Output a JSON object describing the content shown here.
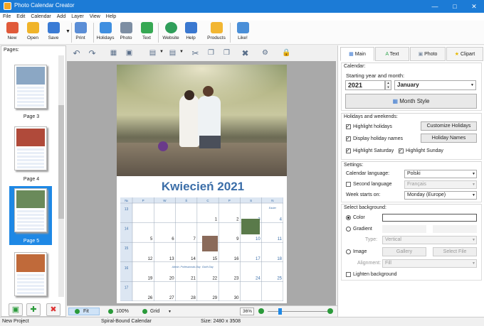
{
  "window": {
    "title": "Photo Calendar Creator"
  },
  "menu": [
    "File",
    "Edit",
    "Calendar",
    "Add",
    "Layer",
    "View",
    "Help"
  ],
  "toolbar": [
    {
      "label": "New",
      "icon": "new-document-icon",
      "color": "#e05a3a"
    },
    {
      "label": "Open",
      "icon": "open-folder-icon",
      "color": "#f0b429"
    },
    {
      "label": "Save",
      "icon": "save-disk-icon",
      "color": "#3a7bd5"
    },
    {
      "label": "Print",
      "icon": "printer-icon",
      "color": "#5b8ed6"
    },
    {
      "label": "Holidays",
      "icon": "holidays-calendar-icon",
      "color": "#3f8fe0"
    },
    {
      "label": "Photo",
      "icon": "camera-icon",
      "color": "#7d8ea3"
    },
    {
      "label": "Text",
      "icon": "text-letter-a-icon",
      "color": "#36a853"
    },
    {
      "label": "Website",
      "icon": "globe-icon",
      "color": "#2f9e5a"
    },
    {
      "label": "Help",
      "icon": "help-book-icon",
      "color": "#3a78d0"
    },
    {
      "label": "Products",
      "icon": "products-bag-icon",
      "color": "#f2b632"
    },
    {
      "label": "Like!",
      "icon": "thumbs-up-icon",
      "color": "#4a8fd8"
    }
  ],
  "pages_panel": {
    "title": "Pages:",
    "pages": [
      {
        "label": "Page 3",
        "color": "#8ba7c4"
      },
      {
        "label": "Page 4",
        "color": "#b04a3a"
      },
      {
        "label": "Page 5",
        "color": "#6a8a5a"
      },
      {
        "label": "",
        "color": "#c06a3a"
      }
    ]
  },
  "calendar": {
    "heading": "Kwiecień 2021",
    "header_row": [
      "№",
      "P",
      "W",
      "Ś",
      "C",
      "P",
      "S",
      "N"
    ],
    "weeks": [
      {
        "wk": "13",
        "days": [
          "",
          "",
          "",
          "1",
          "2",
          "3",
          "4"
        ]
      },
      {
        "wk": "14",
        "days": [
          "5",
          "6",
          "7",
          "8",
          "9",
          "10",
          "11"
        ]
      },
      {
        "wk": "15",
        "days": [
          "12",
          "13",
          "14",
          "15",
          "16",
          "17",
          "18"
        ]
      },
      {
        "wk": "16",
        "days": [
          "19",
          "20",
          "21",
          "22",
          "23",
          "24",
          "25"
        ]
      },
      {
        "wk": "17",
        "days": [
          "26",
          "27",
          "28",
          "29",
          "30",
          "",
          ""
        ]
      }
    ],
    "note_easter": "Easter",
    "note_prof": "Admin. Professionals Day",
    "note_earth": "Earth Day"
  },
  "bottom": {
    "fit": "Fit",
    "zoom100": "100%",
    "grid": "Grid",
    "zoom": "36%"
  },
  "status": {
    "project": "New Project",
    "type": "Spiral-Bound Calendar",
    "size": "Size: 2480 x 3508"
  },
  "right": {
    "tabs": [
      "Main",
      "Text",
      "Photo",
      "Clipart"
    ],
    "calendar_title": "Calendar:",
    "start_label": "Starting year and month:",
    "year": "2021",
    "month": "January",
    "month_style": "Month Style",
    "holidays_title": "Holidays and weekends:",
    "highlight_holidays": "Highlight holidays",
    "customize_holidays": "Customize Holidays",
    "display_names": "Display holiday names",
    "holiday_names": "Holiday Names",
    "highlight_saturday": "Highlight Saturday",
    "highlight_sunday": "Highlight Sunday",
    "settings_title": "Settings:",
    "cal_language_label": "Calendar language:",
    "cal_language": "Polski",
    "second_language_label": "Second language",
    "second_language": "Français",
    "week_starts_label": "Week starts on:",
    "week_starts": "Monday (Europe)",
    "bg_title": "Select background:",
    "color_label": "Color",
    "gradient_label": "Gradient",
    "type_label": "Type:",
    "type_value": "Vertical",
    "image_label": "Image",
    "gallery": "Gallery",
    "select_file": "Select File",
    "alignment_label": "Alignment:",
    "alignment_value": "Fill",
    "lighten": "Lighten background"
  }
}
